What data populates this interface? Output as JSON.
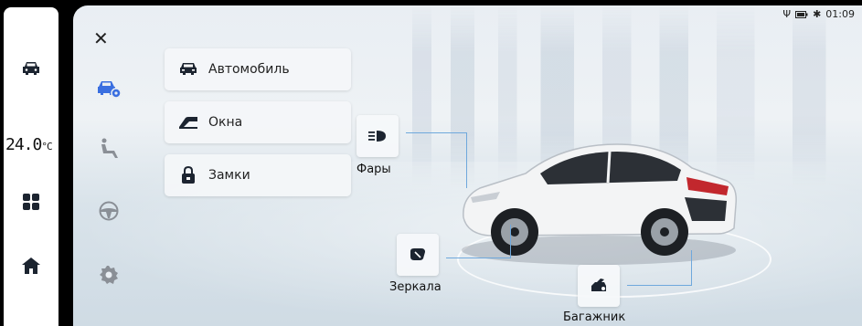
{
  "dock": {
    "temperature": "24.0",
    "temperature_unit": "°C",
    "icons": [
      "car-icon",
      "grid-apps-icon",
      "home-icon"
    ]
  },
  "status_bar": {
    "time": "01:09",
    "icons": [
      "usb-icon",
      "battery-icon",
      "bluetooth-icon"
    ]
  },
  "side_nav": {
    "items": [
      {
        "icon": "car-settings-icon",
        "active": true
      },
      {
        "icon": "seat-icon",
        "active": false
      },
      {
        "icon": "steering-wheel-icon",
        "active": false
      },
      {
        "icon": "gear-icon",
        "active": false
      }
    ]
  },
  "menu": {
    "items": [
      {
        "label": "Автомобиль",
        "icon": "car-icon"
      },
      {
        "label": "Окна",
        "icon": "window-icon"
      },
      {
        "label": "Замки",
        "icon": "lock-icon"
      }
    ]
  },
  "hotspots": {
    "headlights": {
      "label": "Фары",
      "icon": "headlight-icon"
    },
    "mirrors": {
      "label": "Зеркала",
      "icon": "mirror-icon"
    },
    "trunk": {
      "label": "Багажник",
      "icon": "trunk-icon"
    }
  },
  "colors": {
    "accent": "#3a6fe0",
    "icon_gray": "#8a8f96",
    "text": "#222222"
  }
}
